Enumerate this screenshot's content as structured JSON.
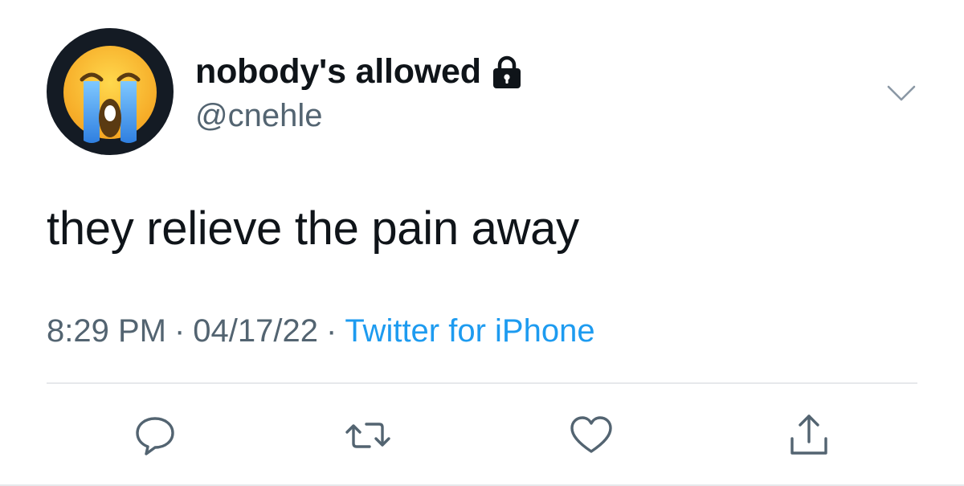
{
  "tweet": {
    "display_name": "nobody's allowed",
    "handle": "@cnehle",
    "text": "they relieve the pain away",
    "time": "8:29 PM",
    "separator": "·",
    "date": "04/17/22",
    "source": "Twitter for iPhone",
    "protected": true
  },
  "icons": {
    "avatar": "loudly-crying-face-icon",
    "lock": "lock-icon",
    "caret": "chevron-down-icon",
    "reply": "reply-icon",
    "retweet": "retweet-icon",
    "like": "heart-icon",
    "share": "share-icon"
  },
  "colors": {
    "text": "#0f1419",
    "secondary": "#536471",
    "link": "#1d9bf0",
    "divider": "#e6e8eb",
    "icon": "#536471"
  }
}
